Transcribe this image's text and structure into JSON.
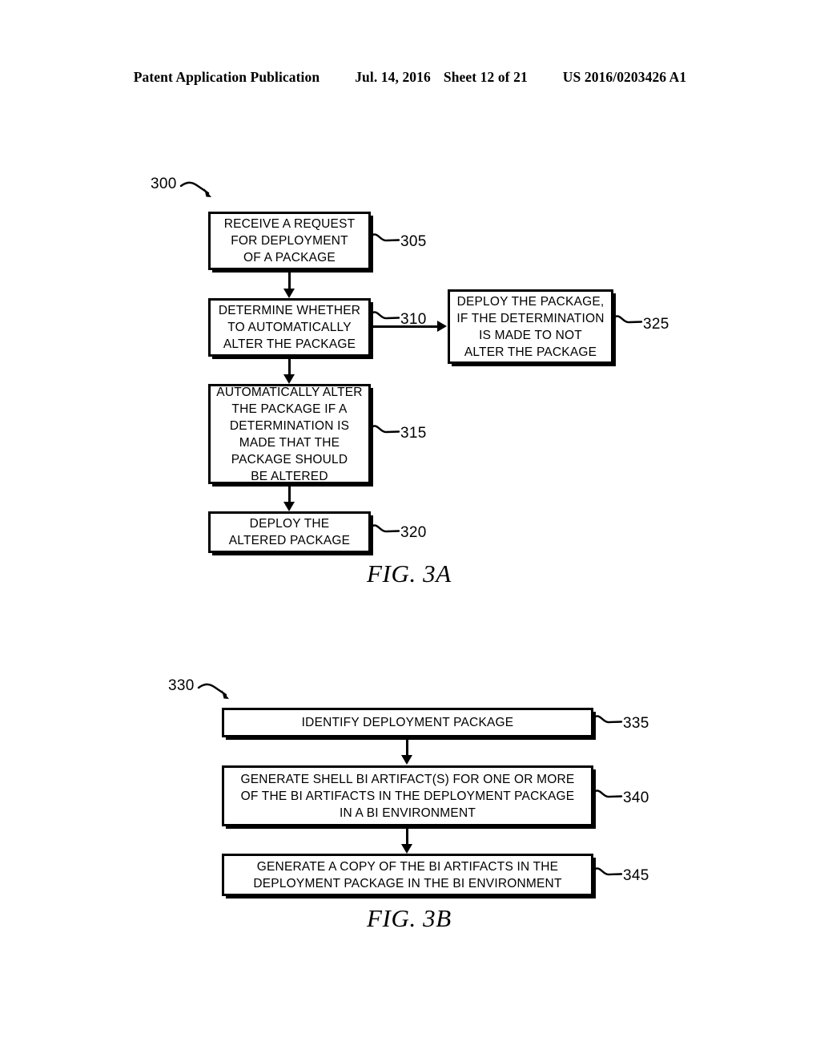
{
  "header": {
    "publication": "Patent Application Publication",
    "date": "Jul. 14, 2016",
    "sheet": "Sheet 12 of 21",
    "patent_number": "US 2016/0203426 A1"
  },
  "figures": [
    {
      "caption": "FIG. 3A",
      "diagram_ref": "300",
      "boxes": [
        {
          "ref": "305",
          "lines": [
            "RECEIVE A REQUEST",
            "FOR DEPLOYMENT",
            "OF A PACKAGE"
          ]
        },
        {
          "ref": "310",
          "lines": [
            "DETERMINE WHETHER",
            "TO AUTOMATICALLY",
            "ALTER THE PACKAGE"
          ]
        },
        {
          "ref": "325",
          "lines": [
            "DEPLOY THE PACKAGE,",
            "IF THE DETERMINATION",
            "IS MADE TO NOT",
            "ALTER THE PACKAGE"
          ]
        },
        {
          "ref": "315",
          "lines": [
            "AUTOMATICALLY ALTER",
            "THE PACKAGE IF A",
            "DETERMINATION IS",
            "MADE THAT THE",
            "PACKAGE SHOULD",
            "BE ALTERED"
          ]
        },
        {
          "ref": "320",
          "lines": [
            "DEPLOY THE",
            "ALTERED PACKAGE"
          ]
        }
      ]
    },
    {
      "caption": "FIG. 3B",
      "diagram_ref": "330",
      "boxes": [
        {
          "ref": "335",
          "lines": [
            "IDENTIFY DEPLOYMENT PACKAGE"
          ]
        },
        {
          "ref": "340",
          "lines": [
            "GENERATE SHELL BI ARTIFACT(S) FOR ONE OR MORE",
            "OF THE BI ARTIFACTS IN THE DEPLOYMENT PACKAGE",
            "IN A BI ENVIRONMENT"
          ]
        },
        {
          "ref": "345",
          "lines": [
            "GENERATE A COPY OF THE BI ARTIFACTS IN THE",
            "DEPLOYMENT PACKAGE IN THE BI ENVIRONMENT"
          ]
        }
      ]
    }
  ],
  "colors": {
    "ink": "#000000",
    "paper": "#ffffff"
  }
}
